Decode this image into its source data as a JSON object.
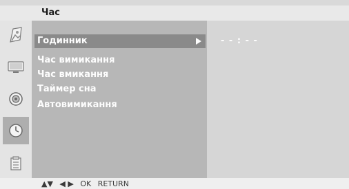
{
  "header": {
    "title": "Час"
  },
  "icons": [
    {
      "name": "picture-icon",
      "selected": false
    },
    {
      "name": "screen-icon",
      "selected": false
    },
    {
      "name": "sound-icon",
      "selected": false
    },
    {
      "name": "clock-icon",
      "selected": true
    },
    {
      "name": "option-icon",
      "selected": false
    }
  ],
  "menu": {
    "items": [
      {
        "label": "Годинник",
        "highlighted": true
      },
      {
        "label": "Час вимикання",
        "highlighted": false
      },
      {
        "label": "Час вмикання",
        "highlighted": false
      },
      {
        "label": "Таймер сна",
        "highlighted": false
      },
      {
        "label": "Автовимикання",
        "highlighted": false
      }
    ]
  },
  "value": {
    "clock_text": "- - : - -"
  },
  "footer": {
    "updown": "▲▼",
    "leftright": "◀ ▶",
    "ok": "OK",
    "return": "RETURN"
  },
  "colors": {
    "highlight": "#8a8a8a",
    "panel": "#b7b7b7",
    "text": "#fdfdfd"
  }
}
